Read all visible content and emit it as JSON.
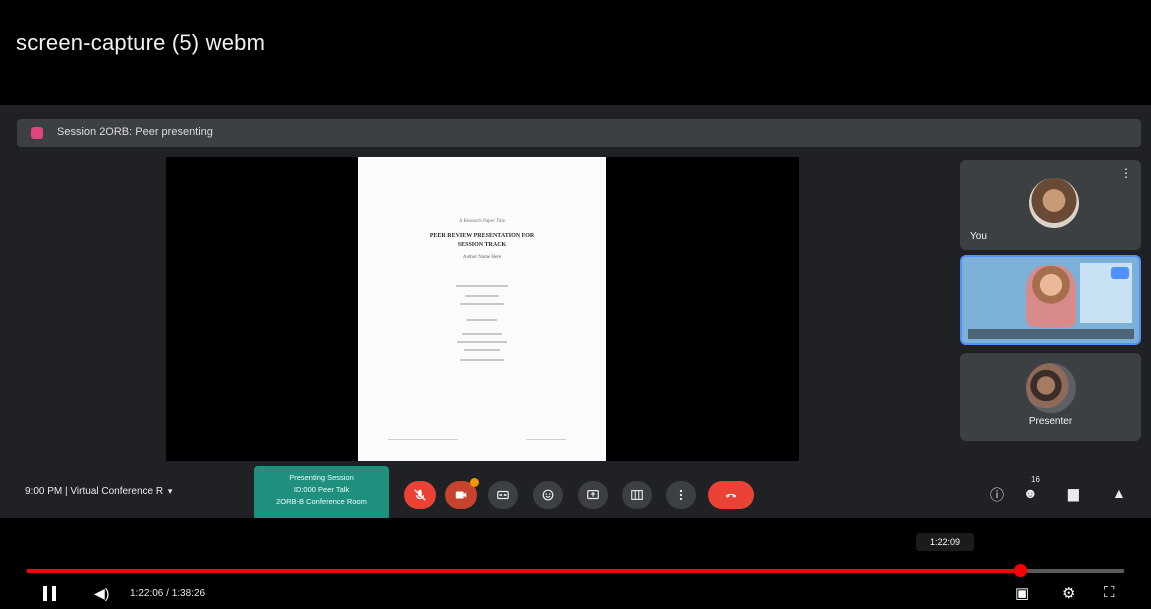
{
  "video": {
    "title": "screen-capture (5) webm"
  },
  "recording_banner": {
    "text": "Session 2ORB: Peer presenting"
  },
  "document": {
    "lines": [
      "A Research Paper Title",
      "PEER REVIEW PRESENTATION FOR",
      "SESSION TRACK",
      "Author Name Here"
    ]
  },
  "participants": [
    {
      "name": "You"
    },
    {
      "name": ""
    },
    {
      "name": "Presenter"
    }
  ],
  "controls": {
    "time": "9:00 PM",
    "separator": "|",
    "meeting_name": "Virtual Conference R",
    "popup_lines": [
      "Presenting Session",
      "ID:000 Peer Talk",
      "2ORB-B Conference Room"
    ],
    "participant_count": "16"
  },
  "player": {
    "hover_time": "1:22:09",
    "current_time": "1:22:06",
    "total_time": "1:38:26",
    "time_separator": " / ",
    "progress_fraction": 0.9055
  },
  "icons": {
    "mic": "mic-off-icon",
    "camera": "camera-icon",
    "captions": "captions-icon",
    "emoji": "emoji-icon",
    "present": "present-icon",
    "more": "more-options-icon",
    "raise_hand": "raise-hand-icon",
    "end_call": "end-call-icon",
    "info": "info-icon",
    "people": "people-icon",
    "chat": "chat-icon",
    "activities": "activities-icon"
  },
  "colors": {
    "end_call": "#ea4335",
    "popup": "#1f8f7e",
    "progress": "#ff0000",
    "recording": "#e0457b"
  }
}
